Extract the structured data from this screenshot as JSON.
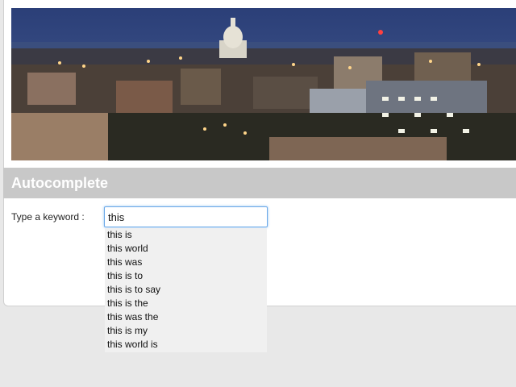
{
  "header": {
    "title": "Autocomplete"
  },
  "hero": {
    "image_name": "city-skyline-photo"
  },
  "form": {
    "label": "Type a keyword :",
    "input_value": "this"
  },
  "suggestions": [
    "this is",
    "this world",
    "this was",
    "this is to",
    "this is to say",
    "this is the",
    "this was the",
    "this is my",
    "this world is"
  ],
  "colors": {
    "title_bar": "#c8c8c8",
    "input_focus_border": "#6aa8e8",
    "suggestions_bg": "#f0f0f0",
    "page_bg": "#e8e8e8"
  }
}
